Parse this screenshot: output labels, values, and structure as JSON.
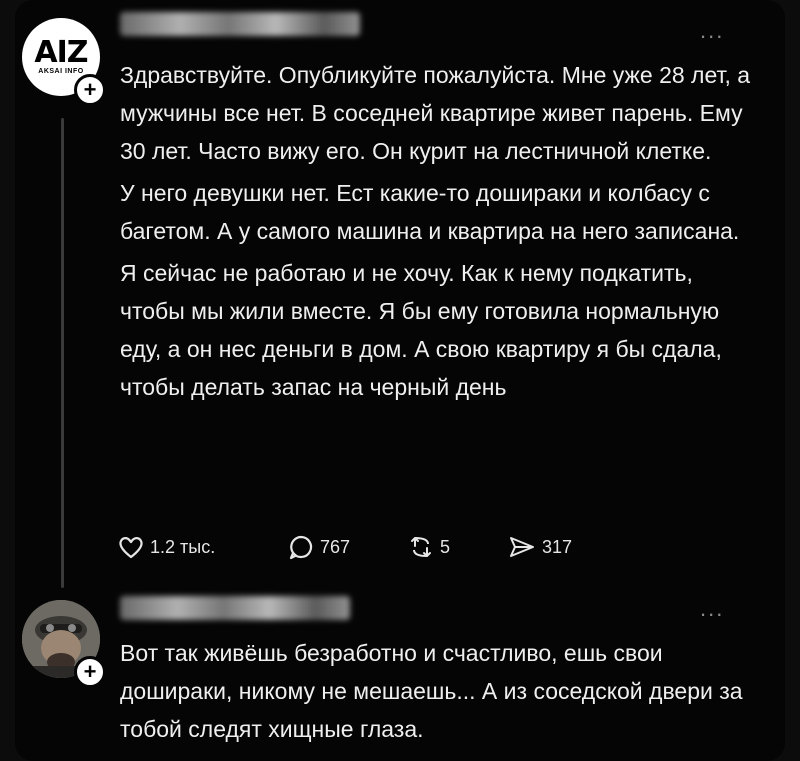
{
  "post1": {
    "avatar_logo": "AIZ",
    "avatar_sub": "AKSAI INFO",
    "paragraphs": [
      "Здравствуйте. Опубликуйте пожалуйста. Мне уже 28 лет, а мужчины все нет. В соседней квартире живет парень. Ему 30 лет. Часто вижу его. Он курит на лестничной клетке.",
      "У него девушки нет. Ест какие-то доширaки и колбасу с багетом. А у самого машина и квартира на него записана.",
      "Я сейчас не работаю и не хочу. Как к нему подкатить, чтобы мы жили вместе. Я бы ему готовила нормальную еду, а он нес деньги в дом. А свою квартиру я бы сдала, чтобы делать запас на черный день"
    ],
    "likes": "1.2 тыс.",
    "comments": "767",
    "reposts": "5",
    "shares": "317"
  },
  "post2": {
    "text": "Вот так живёшь безработно и счастливо, ешь свои доширaки, никому не мешаешь... А из соседской двери за тобой следят хищные глаза."
  },
  "icons": {
    "more": "more-icon",
    "follow": "plus-icon",
    "like": "heart-icon",
    "comment": "comment-icon",
    "repost": "repost-icon",
    "share": "share-icon"
  },
  "ui": {
    "more_glyph": "...",
    "plus_glyph": "+"
  }
}
